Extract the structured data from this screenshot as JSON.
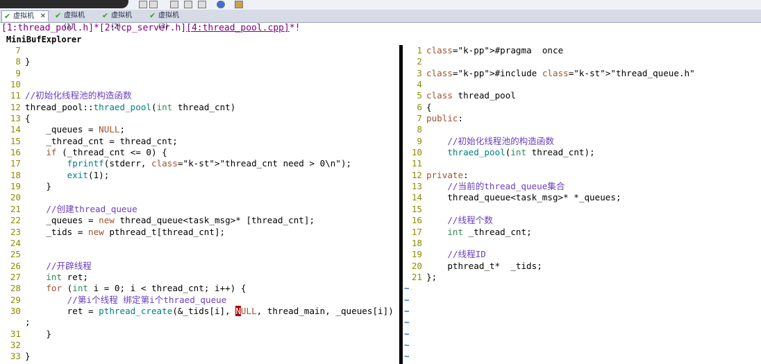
{
  "vm_tabs": [
    {
      "label": "虚拟机",
      "close": "✕",
      "active": true
    },
    {
      "label": "虚拟机 (1)",
      "active": false
    },
    {
      "label": "虚拟机 (2)",
      "active": false
    },
    {
      "label": "虚拟机 (3)",
      "active": false
    }
  ],
  "buffer_line": {
    "b1": "[1:thread_pool.h]*",
    "b2": "[2:tcp_server.h]",
    "b3": "[4:thread_pool.cpp]",
    "b3_suffix": "*!"
  },
  "minibuf_label": "MiniBufExplorer",
  "left_pane": [
    {
      "n": "7",
      "t": ""
    },
    {
      "n": "8",
      "t": "}"
    },
    {
      "n": "9",
      "t": ""
    },
    {
      "n": "10",
      "t": ""
    },
    {
      "n": "11",
      "t": "//初始化线程池的构造函数"
    },
    {
      "n": "12",
      "t": "thread_pool::thraed_pool(int thread_cnt)"
    },
    {
      "n": "13",
      "t": "{"
    },
    {
      "n": "14",
      "t": "    _queues = NULL;"
    },
    {
      "n": "15",
      "t": "    _thread_cnt = thread_cnt;"
    },
    {
      "n": "16",
      "t": "    if (_thread_cnt <= 0) {"
    },
    {
      "n": "17",
      "t": "        fprintf(stderr, \"thread_cnt need > 0\\n\");"
    },
    {
      "n": "18",
      "t": "        exit(1);"
    },
    {
      "n": "19",
      "t": "    }"
    },
    {
      "n": "20",
      "t": ""
    },
    {
      "n": "21",
      "t": "    //创建thread_queue"
    },
    {
      "n": "22",
      "t": "    _queues = new thread_queue<task_msg>* [thread_cnt];"
    },
    {
      "n": "23",
      "t": "    _tids = new pthread_t[thread_cnt];"
    },
    {
      "n": "24",
      "t": ""
    },
    {
      "n": "25",
      "t": ""
    },
    {
      "n": "26",
      "t": "    //开辟线程"
    },
    {
      "n": "27",
      "t": "    int ret;"
    },
    {
      "n": "28",
      "t": "    for (int i = 0; i < thread_cnt; i++) {"
    },
    {
      "n": "29",
      "t": "        //第i个线程 绑定第i个thraed_queue"
    },
    {
      "n": "30",
      "t": "        ret = pthread_create(&_tids[i], NULL, thread_main, _queues[i])"
    },
    {
      "n": "",
      "t": ";"
    },
    {
      "n": "31",
      "t": "    }"
    },
    {
      "n": "32",
      "t": ""
    },
    {
      "n": "33",
      "t": "}"
    }
  ],
  "right_pane": [
    {
      "n": "1",
      "t": "#pragma  once"
    },
    {
      "n": "2",
      "t": ""
    },
    {
      "n": "3",
      "t": "#include \"thread_queue.h\""
    },
    {
      "n": "4",
      "t": ""
    },
    {
      "n": "5",
      "t": "class thread_pool"
    },
    {
      "n": "6",
      "t": "{"
    },
    {
      "n": "7",
      "t": "public:"
    },
    {
      "n": "8",
      "t": ""
    },
    {
      "n": "9",
      "t": "    //初始化线程池的构造函数"
    },
    {
      "n": "10",
      "t": "    thraed_pool(int thread_cnt);"
    },
    {
      "n": "11",
      "t": ""
    },
    {
      "n": "12",
      "t": "private:"
    },
    {
      "n": "13",
      "t": "    //当前的thread_queue集合"
    },
    {
      "n": "14",
      "t": "    thread_queue<task_msg>* *_queues;"
    },
    {
      "n": "15",
      "t": ""
    },
    {
      "n": "16",
      "t": "    //线程个数"
    },
    {
      "n": "17",
      "t": "    int _thread_cnt;"
    },
    {
      "n": "18",
      "t": ""
    },
    {
      "n": "19",
      "t": "    //线程ID"
    },
    {
      "n": "20",
      "t": "    pthread_t*  _tids;"
    },
    {
      "n": "21",
      "t": "};"
    }
  ],
  "tilde_rows": [
    {
      "t": "~"
    },
    {
      "t": "~"
    },
    {
      "t": "~"
    },
    {
      "t": "~"
    },
    {
      "t": "~"
    },
    {
      "t": "~"
    },
    {
      "t": "~"
    }
  ],
  "colors": {
    "line_number": "#8c8c00",
    "comment": "#6a3fc1",
    "keyword": "#a0522d",
    "string": "#c03030",
    "tilde": "#1e6fd9",
    "buffer_line": "#800080"
  }
}
